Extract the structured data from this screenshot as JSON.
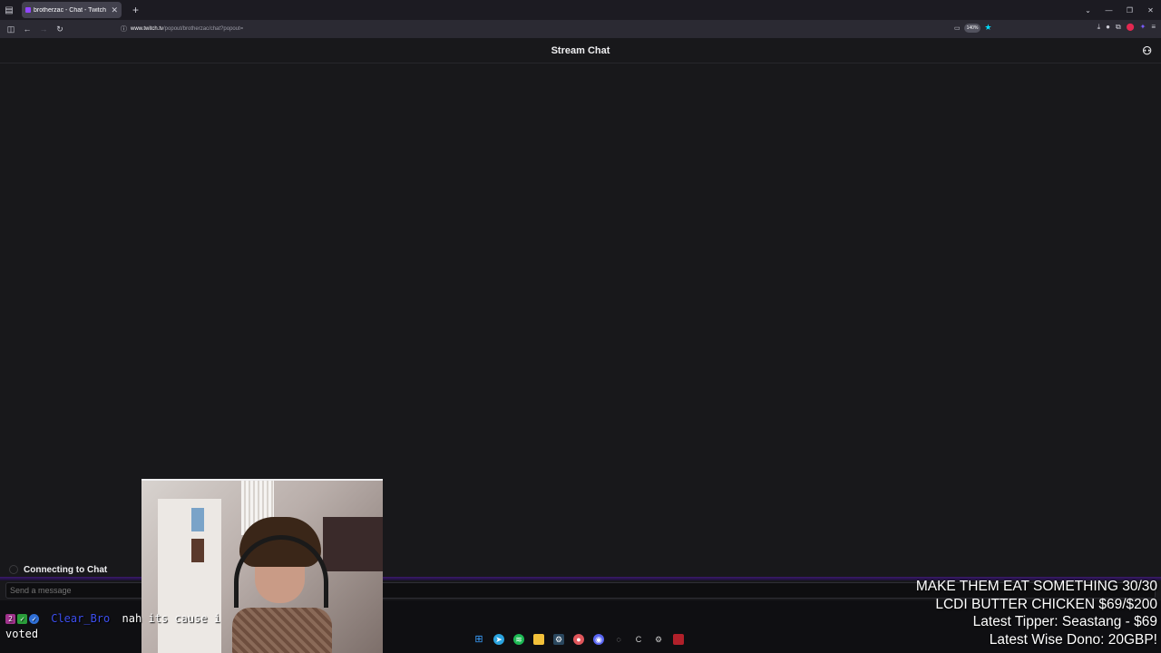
{
  "browser": {
    "tab_title": "brotherzac - Chat - Twitch",
    "new_tab": "+",
    "url_host": "www.twitch.tv",
    "url_path": "/popout/brotherzac/chat?popout=",
    "zoom": "140%"
  },
  "chat": {
    "header_title": "Stream Chat",
    "connecting": "Connecting to Chat",
    "input_placeholder": "Send a message"
  },
  "overlay_message": {
    "badge_count": "2",
    "username": "Clear_Bro",
    "text": "nah its cause i voted"
  },
  "stream_stats": {
    "line1": "MAKE THEM EAT SOMETHING 30/30",
    "line2": "LCDI BUTTER CHICKEN $69/$200",
    "line3": "Latest Tipper: Seastang  - $69",
    "line4": "Latest Wise Dono: 20GBP!"
  },
  "taskbar": {
    "icons": [
      "windows-icon",
      "telegram-icon",
      "spotify-icon",
      "folder-icon",
      "steam-icon",
      "app-icon",
      "discord-icon",
      "browser-icon",
      "ccleaner-icon",
      "settings-icon",
      "app2-icon"
    ]
  },
  "colors": {
    "accent": "#9146ff",
    "username": "#3d4ff0",
    "background": "#18181b"
  }
}
